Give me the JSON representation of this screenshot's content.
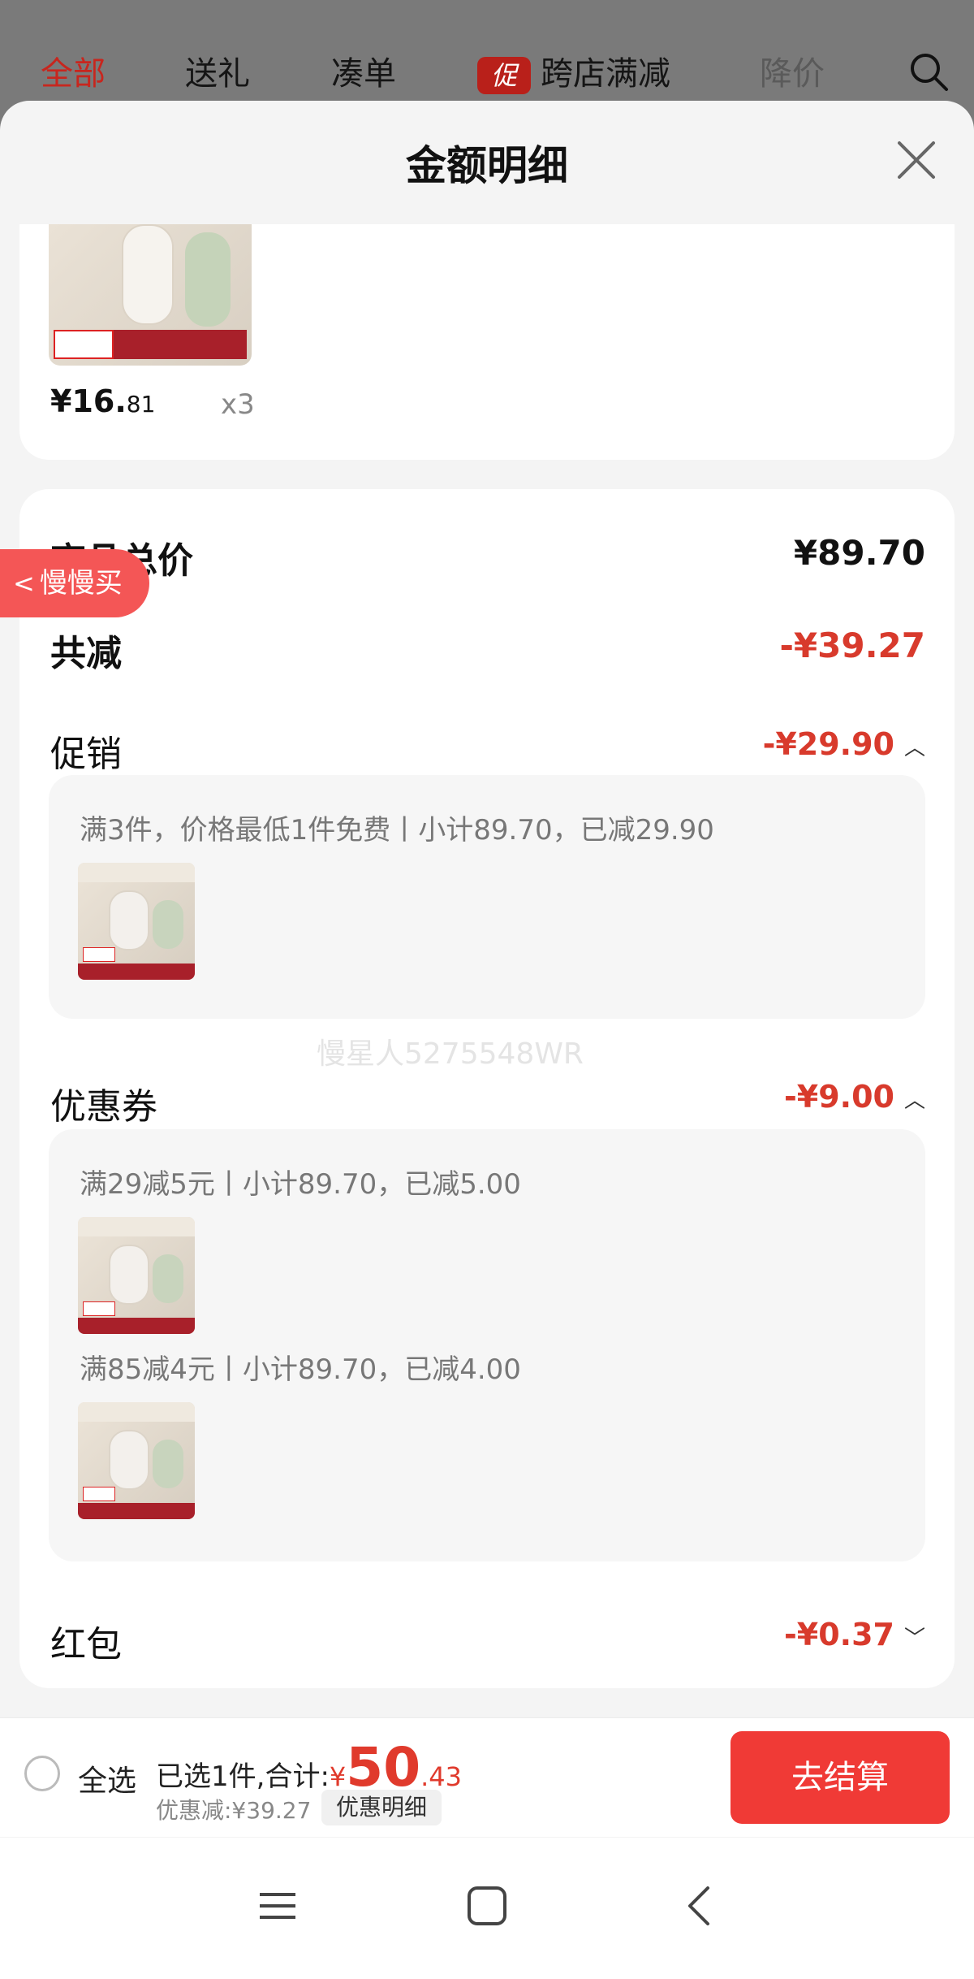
{
  "top_tabs": {
    "all": "全部",
    "gift": "送礼",
    "bundle": "凑单",
    "promo_badge": "促",
    "cross_store": "跨店满减",
    "price_drop": "降价"
  },
  "sheet": {
    "title": "金额明细"
  },
  "product": {
    "price_int": "¥16.",
    "price_dec": "81",
    "qty": "x3"
  },
  "summary": {
    "total_label": "商品总价",
    "total_value": "¥89.70",
    "reduce_label": "共减",
    "reduce_value": "-¥39.27",
    "promo_label": "促销",
    "promo_value": "-¥29.90",
    "promo_detail": "满3件，价格最低1件免费丨小计89.70，已减29.90",
    "coupon_label": "优惠券",
    "coupon_value": "-¥9.00",
    "coupon_detail_1": "满29减5元丨小计89.70，已减5.00",
    "coupon_detail_2": "满85减4元丨小计89.70，已减4.00",
    "redpacket_label": "红包",
    "redpacket_value": "-¥0.37"
  },
  "watermark": "慢星人5275548WR",
  "floating_pill": {
    "label": "慢慢买"
  },
  "checkout": {
    "select_all": "全选",
    "selected_prefix": "已选1件,合计:",
    "currency": "¥",
    "total_int": "50",
    "total_dec": ".43",
    "discount_text": "优惠减:¥39.27",
    "detail_button": "优惠明细",
    "checkout_button": "去结算"
  },
  "colors": {
    "accent_red": "#e03a2c",
    "button_red": "#f03a36",
    "pill": "#f45656"
  },
  "icons": [
    "search-icon",
    "close-icon",
    "chevron-up-icon",
    "chevron-down-icon",
    "menu-icon",
    "home-icon",
    "back-icon"
  ]
}
